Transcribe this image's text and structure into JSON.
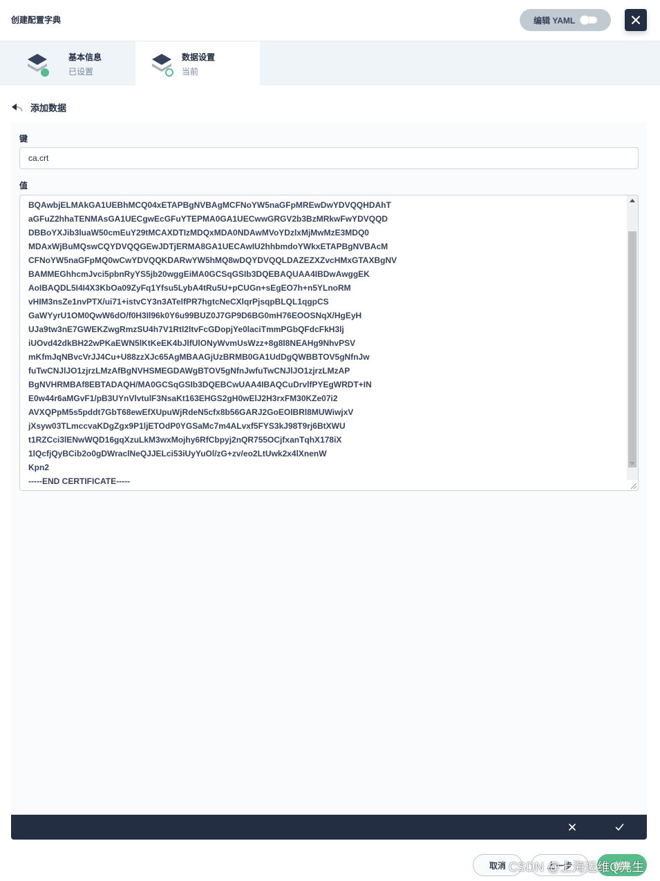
{
  "header": {
    "title": "创建配置字典",
    "yaml_label": "编辑 YAML"
  },
  "steps": [
    {
      "title": "基本信息",
      "status": "已设置",
      "status_color": "#55bc8a"
    },
    {
      "title": "数据设置",
      "status": "当前",
      "status_color": "#55bc8a"
    }
  ],
  "back": {
    "label": "添加数据"
  },
  "form": {
    "key_label": "键",
    "key_value": "ca.crt",
    "value_label": "值",
    "value_lines": [
      "BQAwbjELMAkGA1UEBhMCQ04xETAPBgNVBAgMCFNoYW5naGFpMREwDwYDVQQHDAhT",
      "aGFuZ2hhaTENMAsGA1UECgwEcGFuYTEPMA0GA1UECwwGRGV2b3BzMRkwFwYDVQQD",
      "DBBoYXJib3luaW50cmEuY29tMCAXDTIzMDQxMDA0NDAwMVoYDzlxMjMwMzE3MDQ0",
      "MDAxWjBuMQswCQYDVQQGEwJDTjERMA8GA1UECAwIU2hhbmdoYWkxETAPBgNVBAcM",
      "CFNoYW5naGFpMQ0wCwYDVQQKDARwYW5hMQ8wDQYDVQQLDAZEZXZvcHMxGTAXBgNV",
      "BAMMEGhhcmJvci5pbnRyYS5jb20wggEiMA0GCSqGSIb3DQEBAQUAA4IBDwAwggEK",
      "AoIBAQDL5I4I4X3KbOa09ZyFq1Yfsu5LybA4tRu5U+pCUGn+sEgEO7h+n5YLnoRM",
      "vHIM3nsZe1nvPTX/ui71+istvCY3n3ATelfPR7hgtcNeCXlqrPjsqpBLQL1qgpCS",
      "GaWYyrU1OM0QwW6dO/f0H3Il96k0Y6u99BUZ0J7GP9D6BG0mH76EOOSNqX/HgEyH",
      "UJa9tw3nE7GWEKZwgRmzSU4h7V1Rtl2ltvFcGDopjYe0laciTmmPGbQFdcFkH3lj",
      "iUOvd42dkBH22wPKaEWN5lKtKeEK4bJlfUlONyWvmUsWzz+8g8l8NEAHg9NhvPSV",
      "mKfmJqNBvcVrJJ4Cu+U88zzXJc65AgMBAAGjUzBRMB0GA1UdDgQWBBTOV5gNfnJw",
      "fuTwCNJlJO1zjrzLMzAfBgNVHSMEGDAWgBTOV5gNfnJwfuTwCNJlJO1zjrzLMzAP",
      "BgNVHRMBAf8EBTADAQH/MA0GCSqGSIb3DQEBCwUAA4IBAQCuDrvlfPYEgWRDT+IN",
      "E0w44r6aMGvF1/pB3UYnVlvtulF3NsaKt163EHGS2gH0wElJ2H3rxFM30KZe07i2",
      "AVXQPpM5s5pddt7GbT68ewEfXUpuWjRdeN5cfx8b56GARJ2GoEOlBRl8MUWiwjxV",
      "jXsyw03TLmccvaKDgZgx9P1ljETOdP0YGSaMc7m4ALvxf5FYS3kJ98T9rj6BtXWU",
      "t1RZCci3lENwWQD16gqXzuLkM3wxMojhy6RfCbpyj2nQR755OCjfxanTqhX178iX",
      "1lQcfjQyBCib2o0gDWraclNeQJJELci53iUyYuOl/zG+zv/eo2LtUwk2x4lXnenW",
      "Kpn2",
      "-----END CERTIFICATE-----"
    ]
  },
  "footer": {
    "cancel_label": "取消",
    "prev_label": "上一步",
    "create_label": "创建"
  },
  "watermark": "CSDN @上海运维Q先生",
  "colors": {
    "dark": "#242e42",
    "accent_green": "#55bc8a",
    "step_bg": "#eff4f9"
  }
}
